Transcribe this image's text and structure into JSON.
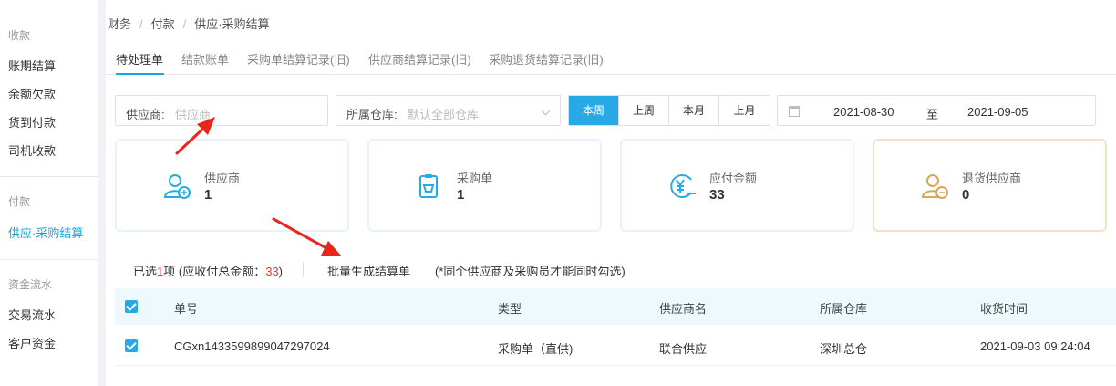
{
  "sidebar": {
    "sections": [
      {
        "title": "收款",
        "items": [
          "账期结算",
          "余额欠款",
          "货到付款",
          "司机收款"
        ]
      },
      {
        "title": "付款",
        "items": [
          "供应·采购结算"
        ]
      },
      {
        "title": "资金流水",
        "items": [
          "交易流水",
          "客户资金"
        ]
      }
    ],
    "active_item": "供应·采购结算"
  },
  "breadcrumb": [
    "财务",
    "付款",
    "供应·采购结算"
  ],
  "tabs": [
    {
      "label": "待处理单",
      "active": true
    },
    {
      "label": "结款账单",
      "active": false
    },
    {
      "label": "采购单结算记录(旧)",
      "active": false
    },
    {
      "label": "供应商结算记录(旧)",
      "active": false
    },
    {
      "label": "采购退货结算记录(旧)",
      "active": false
    }
  ],
  "filters": {
    "supplier": {
      "label": "供应商:",
      "placeholder": "供应商"
    },
    "warehouse": {
      "label": "所属仓库:",
      "placeholder": "默认全部仓库"
    }
  },
  "period_buttons": [
    {
      "label": "本周",
      "active": true
    },
    {
      "label": "上周",
      "active": false
    },
    {
      "label": "本月",
      "active": false
    },
    {
      "label": "上月",
      "active": false
    }
  ],
  "date_range": {
    "start": "2021-08-30",
    "separator": "至",
    "end": "2021-09-05"
  },
  "cards": [
    {
      "label": "供应商",
      "value": "1",
      "icon": "supplier-icon"
    },
    {
      "label": "采购单",
      "value": "1",
      "icon": "purchase-order-icon"
    },
    {
      "label": "应付金额",
      "value": "33",
      "icon": "payable-amount-icon"
    },
    {
      "label": "退货供应商",
      "value": "0",
      "icon": "return-supplier-icon"
    }
  ],
  "summary": {
    "prefix": "已选",
    "count": "1",
    "middle": "项 (应收付总金额：",
    "amount": "33",
    "suffix": ")",
    "batch_button": "批量生成结算单",
    "note": "(*同个供应商及采购员才能同时勾选)"
  },
  "table": {
    "columns": [
      "单号",
      "类型",
      "供应商名",
      "所属仓库",
      "收货时间"
    ],
    "rows": [
      {
        "checked": true,
        "order_no": "CGxn1433599899047297024",
        "type": "采购单（直供)",
        "supplier": "联合供应",
        "warehouse": "深圳总仓",
        "received_at": "2021-09-03 09:24:04"
      }
    ]
  },
  "colors": {
    "accent": "#28a9e6",
    "annotation": "#e8261e",
    "card_border": "#e6f4fa",
    "card_border_alt": "#f3e2c3"
  }
}
